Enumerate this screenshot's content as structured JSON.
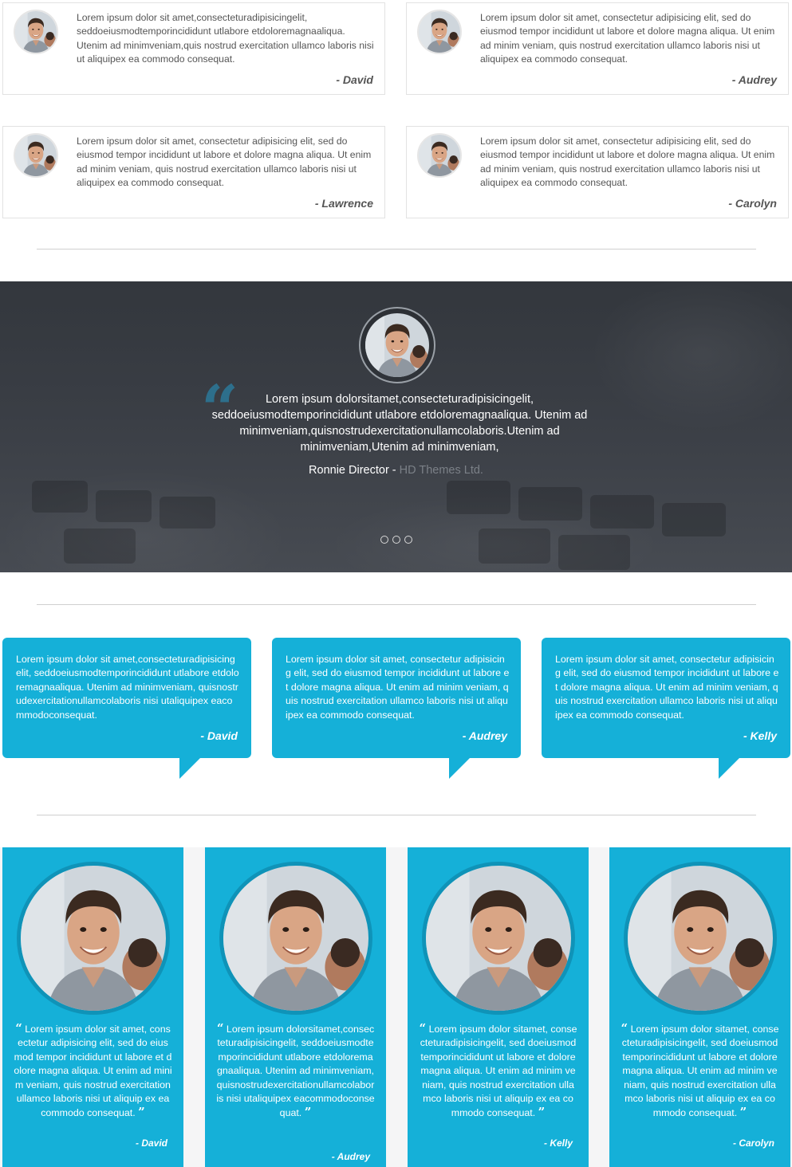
{
  "cards": [
    {
      "text": "Lorem ipsum dolor sit amet,consecteturadipisicingelit, seddoeiusmodtemporincididunt utlabore etdoloremagnaaliqua. Utenim ad minimveniam,quis nostrud exercitation ullamco laboris nisi ut aliquipex ea commodo consequat.",
      "author": "- David"
    },
    {
      "text": "Lorem ipsum dolor sit amet, consectetur adipisicing elit, sed do eiusmod tempor incididunt ut labore et dolore magna aliqua. Ut enim ad minim veniam, quis nostrud exercitation ullamco laboris nisi ut aliquipex ea commodo consequat.",
      "author": "- Audrey"
    },
    {
      "text": "Lorem ipsum dolor sit amet, consectetur adipisicing elit, sed do eiusmod tempor incididunt ut labore et dolore magna aliqua. Ut enim ad minim veniam, quis nostrud exercitation ullamco laboris nisi ut aliquipex ea commodo consequat.",
      "author": "- Lawrence"
    },
    {
      "text": "Lorem ipsum dolor sit amet, consectetur adipisicing elit, sed do eiusmod tempor incididunt ut labore et dolore magna aliqua. Ut enim ad minim veniam, quis nostrud exercitation ullamco laboris nisi ut aliquipex ea commodo consequat.",
      "author": "- Carolyn"
    }
  ],
  "slider": {
    "quote": "Lorem ipsum dolorsitamet,consecteturadipisicingelit, seddoeiusmodtemporincididunt utlabore etdoloremagnaaliqua. Utenim ad minimveniam,quisnostrudexercitationullamcolaboris.Utenim ad minimveniam,Utenim ad minimveniam,",
    "author": "Ronnie Director -",
    "company": "HD Themes Ltd.",
    "dot_count": 3
  },
  "bubbles": [
    {
      "text": "Lorem ipsum dolor sit amet,consecteturadipisicingelit, seddoeiusmodtemporincididunt utlabore etdoloremagnaaliqua. Utenim ad minimveniam, quisnostrudexercitationullamcolaboris nisi utaliquipex eacommodoconsequat.",
      "author": "- David"
    },
    {
      "text": "Lorem ipsum dolor sit amet, consectetur adipisicing elit, sed do eiusmod tempor incididunt ut labore et dolore magna aliqua. Ut enim ad minim veniam, quis nostrud exercitation ullamco laboris nisi ut aliquipex ea commodo consequat.",
      "author": "- Audrey"
    },
    {
      "text": "Lorem ipsum dolor sit amet, consectetur adipisicing elit, sed do eiusmod tempor incididunt ut labore et dolore magna aliqua. Ut enim ad minim veniam, quis nostrud exercitation ullamco laboris nisi ut aliquipex ea commodo consequat.",
      "author": "- Kelly"
    }
  ],
  "columns": [
    {
      "text": "Lorem ipsum dolor sit amet, consectetur adipisicing elit, sed do eiusmod tempor incididunt ut labore et dolore magna aliqua. Ut enim ad minim veniam, quis nostrud exercitation ullamco laboris nisi ut aliquip ex ea commodo consequat.",
      "author": "- David"
    },
    {
      "text": "Lorem ipsum dolorsitamet,consecteturadipisicingelit, seddoeiusmodtemporincididunt utlabore etdoloremagnaaliqua. Utenim ad minimveniam,quisnostrudexercitationullamcolaboris nisi utaliquipex eacommodoconsequat.",
      "author": "-  Audrey"
    },
    {
      "text": "Lorem ipsum dolor sitamet, consecteturadipisicingelit, sed doeiusmodtemporincididunt ut labore et dolore magna aliqua. Ut enim ad minim veniam, quis nostrud exercitation ullamco laboris nisi ut aliquip ex ea commodo consequat.",
      "author": "- Kelly"
    },
    {
      "text": "Lorem ipsum dolor sitamet, consecteturadipisicingelit, sed doeiusmodtemporincididunt ut labore et dolore magna aliqua. Ut enim ad minim veniam, quis nostrud exercitation ullamco laboris nisi ut aliquip ex ea commodo consequat.",
      "author": "- Carolyn"
    }
  ],
  "colors": {
    "accent": "#15b0d8",
    "accent_dark": "#0f93b8",
    "slider_bg": "#3a3e45",
    "quote_icon": "#2d6f8c"
  },
  "icons": {
    "avatar": "person-photo-icon",
    "open_quote": "open-quote-icon",
    "close_quote": "close-quote-icon"
  }
}
